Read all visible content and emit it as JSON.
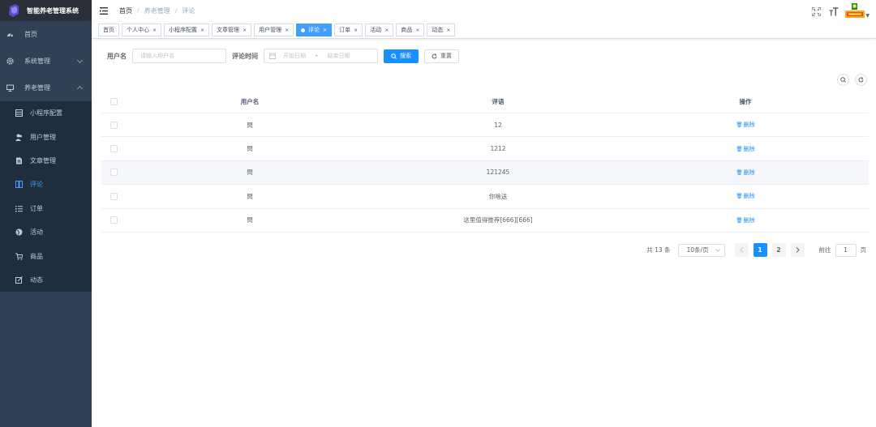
{
  "app": {
    "title": "智能养老管理系统"
  },
  "colors": {
    "sidebar_bg": "#304156",
    "accent": "#1890ff",
    "active_tag": "#409eff"
  },
  "sidebar": {
    "items": [
      {
        "label": "首页",
        "icon": "dashboard-icon"
      },
      {
        "label": "系统管理",
        "icon": "gear-icon",
        "expandable": true,
        "expanded": false
      },
      {
        "label": "养老管理",
        "icon": "monitor-icon",
        "expandable": true,
        "expanded": true
      }
    ],
    "subitems": [
      {
        "label": "小程序配置",
        "icon": "grid-icon"
      },
      {
        "label": "用户管理",
        "icon": "users-icon"
      },
      {
        "label": "文章管理",
        "icon": "document-icon"
      },
      {
        "label": "评论",
        "icon": "columns-icon",
        "active": true
      },
      {
        "label": "订单",
        "icon": "list-icon"
      },
      {
        "label": "活动",
        "icon": "globe-icon"
      },
      {
        "label": "商品",
        "icon": "cart-icon"
      },
      {
        "label": "动态",
        "icon": "edit-icon"
      }
    ]
  },
  "breadcrumb": [
    "首页",
    "养老管理",
    "评论"
  ],
  "tags": [
    {
      "label": "首页",
      "closable": false,
      "active": false
    },
    {
      "label": "个人中心",
      "closable": true,
      "active": false
    },
    {
      "label": "小程序配置",
      "closable": true,
      "active": false
    },
    {
      "label": "文章管理",
      "closable": true,
      "active": false
    },
    {
      "label": "用户管理",
      "closable": true,
      "active": false
    },
    {
      "label": "评论",
      "closable": true,
      "active": true
    },
    {
      "label": "订单",
      "closable": true,
      "active": false
    },
    {
      "label": "活动",
      "closable": true,
      "active": false
    },
    {
      "label": "商品",
      "closable": true,
      "active": false
    },
    {
      "label": "动态",
      "closable": true,
      "active": false
    }
  ],
  "tag_close_glyph": "×",
  "search": {
    "username_label": "用户名",
    "username_placeholder": "请输入用户名",
    "time_label": "评论时间",
    "start_placeholder": "开始日期",
    "range_separator": "-",
    "end_placeholder": "结束日期",
    "search_button": "搜索",
    "reset_button": "重置"
  },
  "table": {
    "columns": [
      "用户名",
      "评语",
      "操作"
    ],
    "rows": [
      {
        "user": "閆",
        "comment": "12",
        "action": "删除"
      },
      {
        "user": "閆",
        "comment": "1212",
        "action": "删除"
      },
      {
        "user": "閆",
        "comment": "121245",
        "action": "删除"
      },
      {
        "user": "閆",
        "comment": "你啥送",
        "action": "删除"
      },
      {
        "user": "閆",
        "comment": "这里值得推荐[666][666]",
        "action": "删除"
      }
    ]
  },
  "pagination": {
    "total_text": "共 13 条",
    "page_size": "10条/页",
    "pages": [
      "1",
      "2"
    ],
    "current_page": 1,
    "jump_prefix": "前往",
    "jump_value": "1",
    "jump_suffix": "页"
  }
}
